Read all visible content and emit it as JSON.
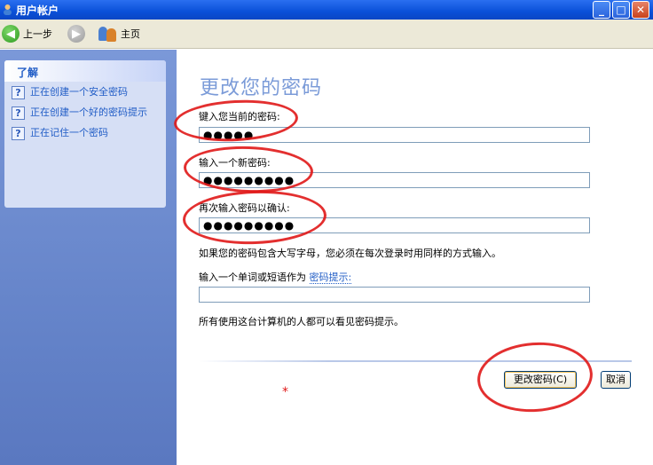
{
  "window": {
    "title": "用户帐户",
    "min_glyph": "_",
    "max_glyph": "□",
    "close_glyph": "✕"
  },
  "toolbar": {
    "back_label": "上一步",
    "home_label": "主页"
  },
  "sidebar": {
    "heading": "了解",
    "items": [
      {
        "label": "正在创建一个安全密码"
      },
      {
        "label": "正在创建一个好的密码提示"
      },
      {
        "label": "正在记住一个密码"
      }
    ]
  },
  "main": {
    "title": "更改您的密码",
    "current_label": "键入您当前的密码:",
    "current_value": "●●●●●",
    "new_label": "输入一个新密码:",
    "new_value": "●●●●●●●●●",
    "confirm_label": "再次输入密码以确认:",
    "confirm_value": "●●●●●●●●●",
    "caps_note": "如果您的密码包含大写字母，您必须在每次登录时用同样的方式输入。",
    "hint_label_prefix": "输入一个单词或短语作为",
    "hint_link": "密码提示:",
    "hint_value": "",
    "visibility_note": "所有使用这台计算机的人都可以看见密码提示。",
    "change_button": "更改密码(C)",
    "cancel_button": "取消"
  },
  "annotations": {
    "mark": "*",
    "color": "#e01818"
  }
}
